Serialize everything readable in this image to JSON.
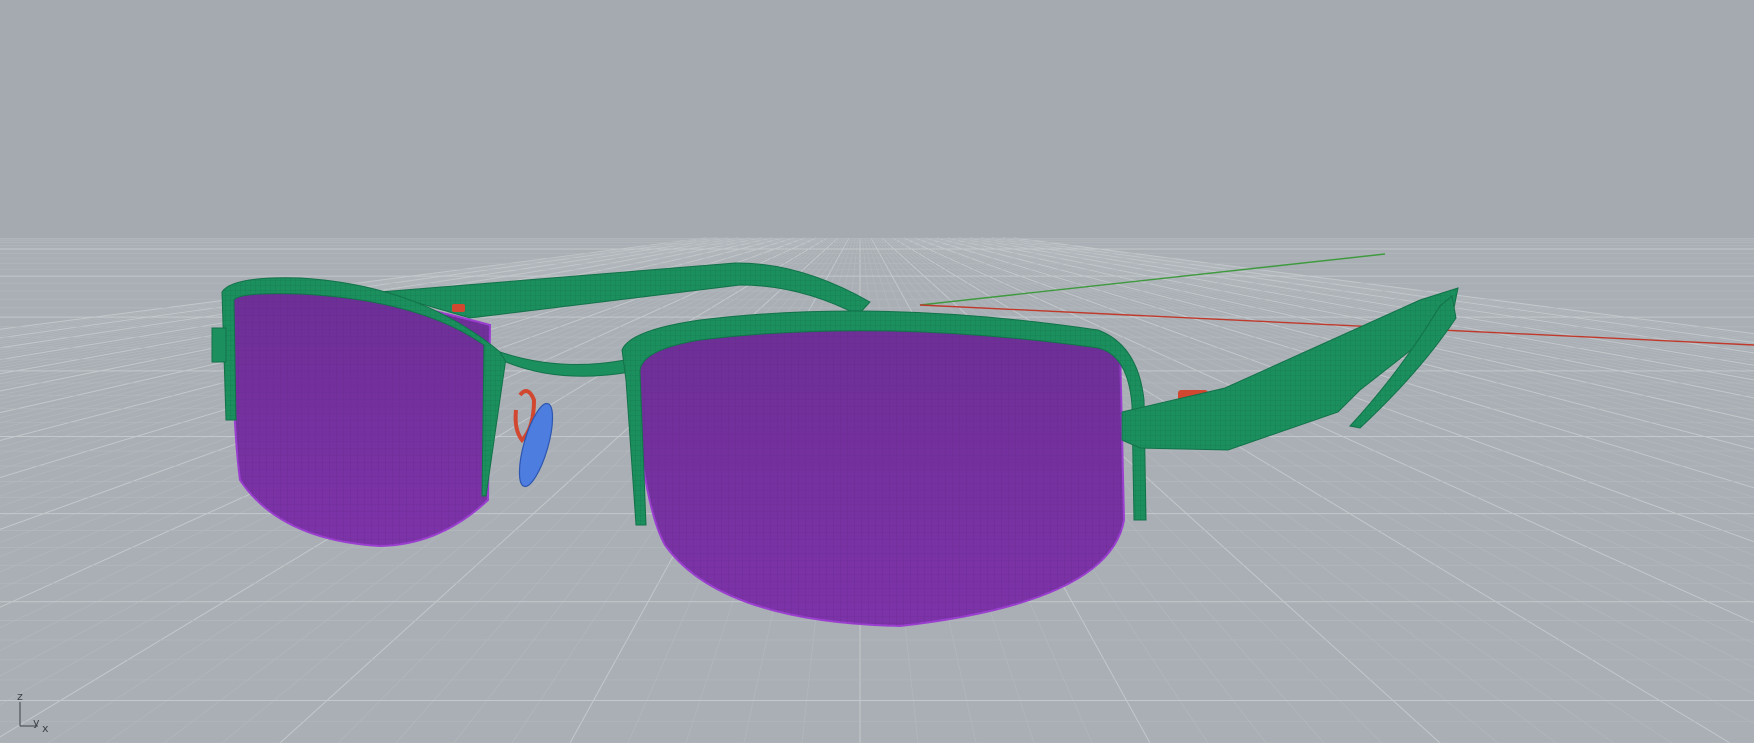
{
  "viewport": {
    "axis_indicator": {
      "z_label": "z",
      "y_label": "y",
      "x_label": "x"
    }
  },
  "colors": {
    "background": "#a4aab0",
    "grid_line": "#b2b8bd",
    "grid_major": "#c3c8cc",
    "frame": "#1b8f5e",
    "frame_dark": "#13724a",
    "lens": "#7e36a6",
    "lens_edge": "#9b3fd0",
    "hinge_screw": "#d2472f",
    "nose_pad": "#4e7de0",
    "x_axis": "#c0392b",
    "y_axis": "#3f9a3f"
  },
  "icons": {
    "axis_icon": "axis-icon",
    "model": "eyeglasses-model-icon"
  }
}
